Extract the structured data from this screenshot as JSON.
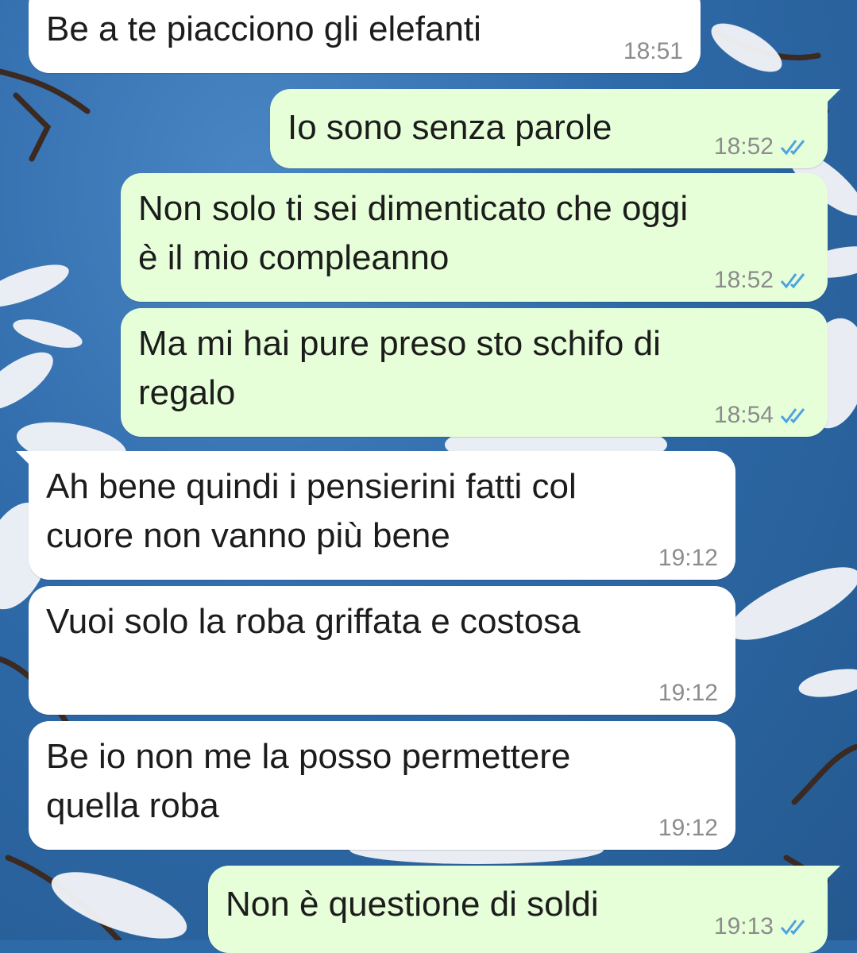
{
  "chat": {
    "messages": [
      {
        "direction": "in",
        "text": "Be a te piacciono gli elefanti",
        "time": "18:51"
      },
      {
        "direction": "out",
        "text": "Io sono senza parole",
        "time": "18:52",
        "status": "read-icon"
      },
      {
        "direction": "out",
        "text": "Non solo ti sei dimenticato che oggi\nè il mio compleanno",
        "time": "18:52",
        "status": "read-icon"
      },
      {
        "direction": "out",
        "text": "Ma mi hai pure preso sto schifo di\nregalo",
        "time": "18:54",
        "status": "read-icon"
      },
      {
        "direction": "in",
        "text": "Ah bene quindi i pensierini fatti col\ncuore non vanno più bene",
        "time": "19:12"
      },
      {
        "direction": "in",
        "text": "Vuoi solo la roba griffata e costosa",
        "time": "19:12"
      },
      {
        "direction": "in",
        "text": "Be io non me la posso permettere\nquella roba",
        "time": "19:12"
      },
      {
        "direction": "out",
        "text": "Non è questione di soldi",
        "time": "19:13",
        "status": "read-icon"
      }
    ]
  },
  "colors": {
    "incoming_bubble": "#ffffff",
    "outgoing_bubble": "#e6ffd9",
    "read_tick": "#4fa3e0",
    "wallpaper": "#2f6aa8"
  }
}
